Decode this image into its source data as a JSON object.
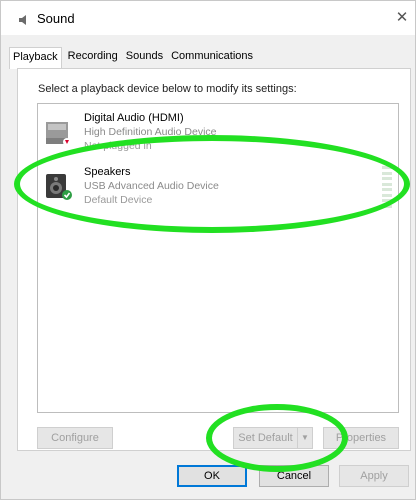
{
  "window": {
    "title": "Sound",
    "close_glyph": "✕",
    "icon": "speaker-icon"
  },
  "tabs": [
    {
      "label": "Playback",
      "active": true
    },
    {
      "label": "Recording",
      "active": false
    },
    {
      "label": "Sounds",
      "active": false
    },
    {
      "label": "Communications",
      "active": false
    }
  ],
  "instructions": "Select a playback device below to modify its settings:",
  "devices": [
    {
      "name": "Digital Audio (HDMI)",
      "description": "High Definition Audio Device",
      "status": "Not plugged in",
      "icon": "monitor-speaker-icon",
      "badge": "red-arrow-badge"
    },
    {
      "name": "Speakers",
      "description": "USB Advanced Audio Device",
      "status": "Default Device",
      "icon": "speaker-icon",
      "badge": "green-check-badge"
    }
  ],
  "buttons": {
    "configure": "Configure",
    "set_default": "Set Default",
    "set_default_arrow": "▼",
    "properties": "Properties"
  },
  "footer": {
    "ok": "OK",
    "cancel": "Cancel",
    "apply": "Apply"
  },
  "colors": {
    "annotation": "#22e022",
    "accent": "#0078d7"
  }
}
